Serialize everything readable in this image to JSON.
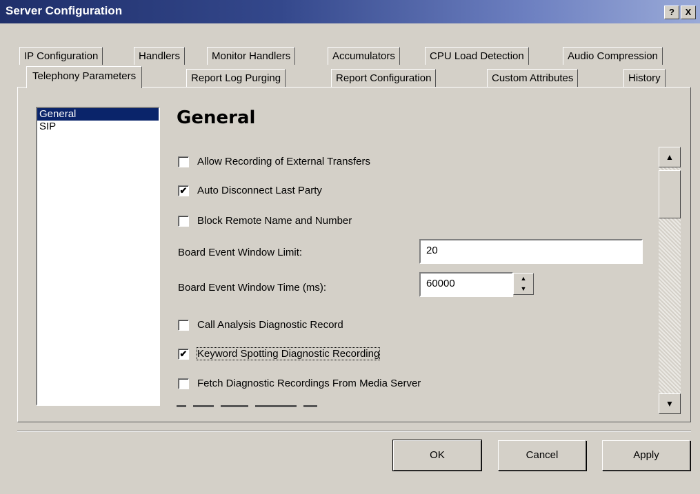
{
  "window": {
    "title": "Server Configuration",
    "help_label": "?",
    "close_label": "X"
  },
  "tabs_row1": [
    {
      "label": "IP Configuration"
    },
    {
      "label": "Handlers"
    },
    {
      "label": "Monitor Handlers"
    },
    {
      "label": "Accumulators"
    },
    {
      "label": "CPU Load Detection"
    },
    {
      "label": "Audio Compression"
    }
  ],
  "tabs_row2": [
    {
      "label": "Telephony Parameters",
      "selected": true
    },
    {
      "label": "Report Log Purging"
    },
    {
      "label": "Report Configuration"
    },
    {
      "label": "Custom Attributes"
    },
    {
      "label": "History"
    }
  ],
  "sidebar": {
    "items": [
      {
        "label": "General",
        "selected": true
      },
      {
        "label": "SIP"
      }
    ]
  },
  "content": {
    "heading": "General",
    "options": [
      {
        "label": "Allow Recording of External Transfers",
        "checked": false
      },
      {
        "label": "Auto Disconnect Last Party",
        "checked": true
      },
      {
        "label": "Block Remote Name and Number",
        "checked": false
      },
      {
        "label": "Call Analysis Diagnostic Record",
        "checked": false
      },
      {
        "label": "Keyword Spotting Diagnostic Recording",
        "checked": true
      },
      {
        "label": "Fetch Diagnostic Recordings From Media Server",
        "checked": false
      }
    ],
    "board_event_window_limit": {
      "label": "Board Event Window Limit:",
      "value": "20"
    },
    "board_event_window_time": {
      "label": "Board Event Window Time (ms):",
      "value": "60000"
    }
  },
  "buttons": {
    "ok": "OK",
    "cancel": "Cancel",
    "apply": "Apply"
  }
}
